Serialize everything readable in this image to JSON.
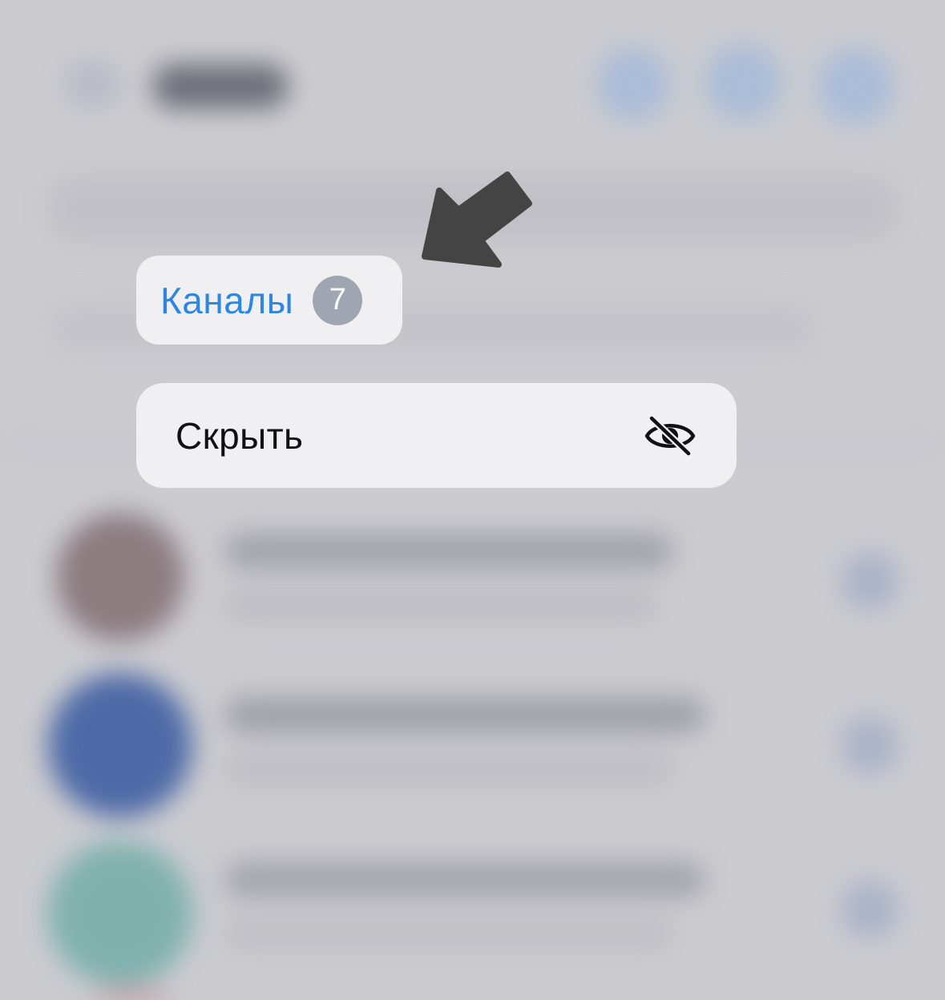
{
  "context_menu": {
    "folder_tab": {
      "label": "Каналы",
      "badge_count": "7"
    },
    "items": [
      {
        "label": "Скрыть",
        "icon": "eye-slash-icon"
      }
    ]
  },
  "annotation": {
    "arrow_icon": "arrow-down-left-icon",
    "arrow_color": "#444444"
  },
  "colors": {
    "accent": "#2f86e2",
    "badge": "#9fa6b1",
    "menu_background": "#f0f0f3",
    "backdrop": "#cbcbd0"
  }
}
